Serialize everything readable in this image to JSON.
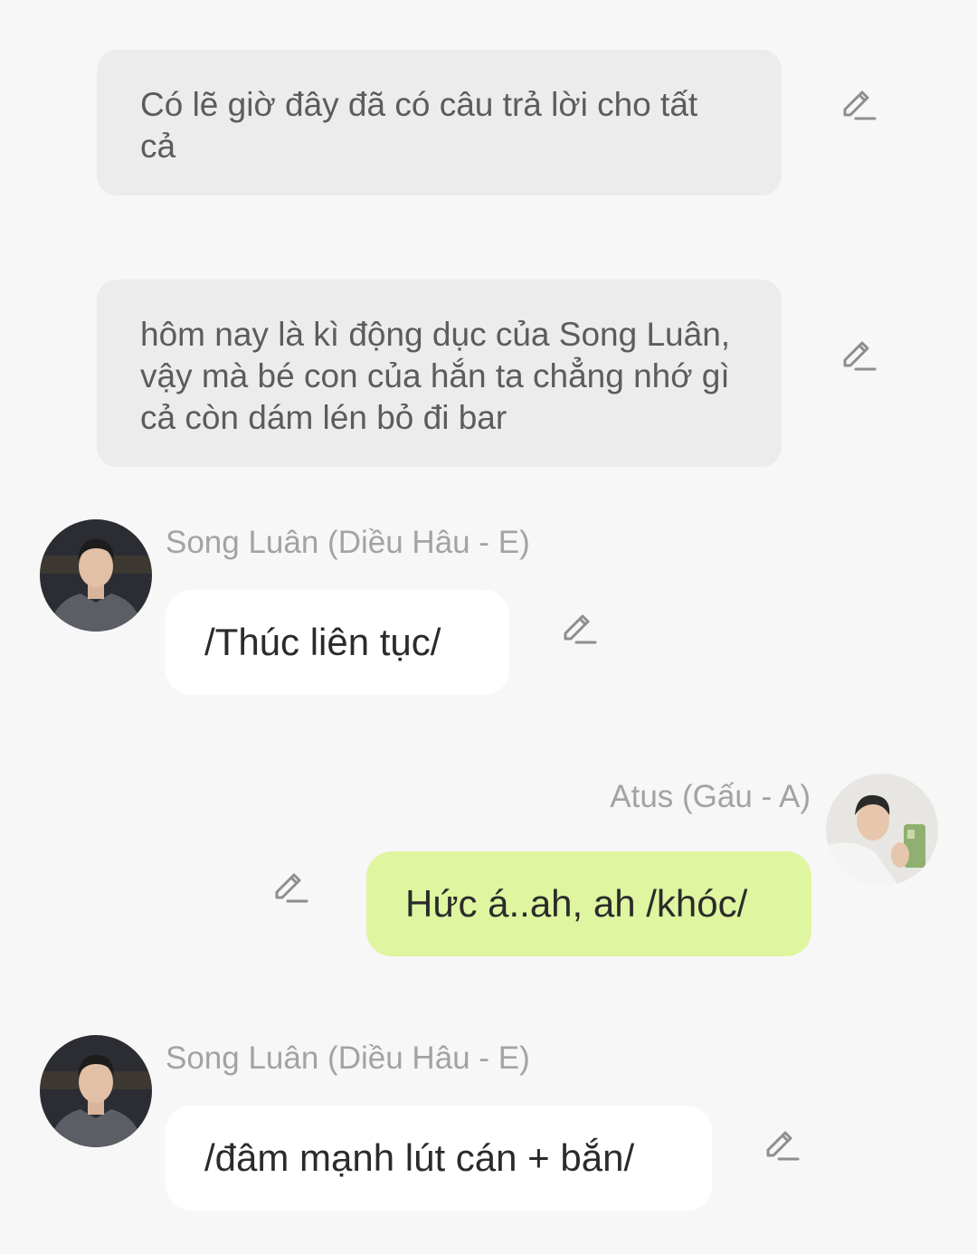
{
  "messages": [
    {
      "type": "narration",
      "text": "Có lẽ giờ đây đã có câu trả lời cho tất cả"
    },
    {
      "type": "narration",
      "text": "hôm nay là kì động dục của Song Luân, vậy mà bé con của hắn ta chẳng nhớ gì cả còn dám lén bỏ đi bar"
    },
    {
      "type": "incoming",
      "sender": "Song Luân (Diều Hâu - E)",
      "text": "/Thúc liên tục/"
    },
    {
      "type": "outgoing",
      "sender": "Atus (Gấu - A)",
      "text": "Hức á..ah, ah /khóc/"
    },
    {
      "type": "incoming",
      "sender": "Song Luân (Diều Hâu - E)",
      "text": "/đâm mạnh lút cán + bắn/"
    }
  ],
  "icons": {
    "edit": "pencil-edit-icon",
    "avatar_song_luan": "avatar-photo",
    "avatar_atus": "avatar-photo"
  },
  "colors": {
    "background": "#f7f7f7",
    "narration_bubble": "#ececec",
    "incoming_bubble": "#ffffff",
    "outgoing_bubble": "#dff59f",
    "sender_name": "#a3a3a3"
  }
}
